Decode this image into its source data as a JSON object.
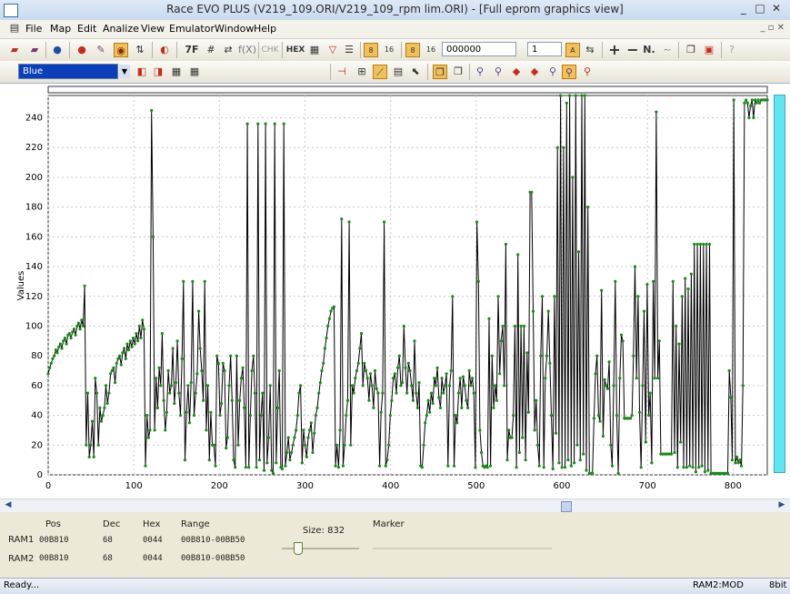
{
  "window": {
    "title": "Race EVO PLUS (V219_109.ORI/V219_109_rpm lim.ORI) - [Full eprom graphics view]"
  },
  "menu": [
    "File",
    "Map",
    "Edit",
    "Analize",
    "View",
    "Emulator",
    "Window",
    "Help"
  ],
  "toolbar": {
    "labels": {
      "hex": "HEX",
      "chk": "CHK",
      "fx": "f(X)",
      "seven_f": "7F"
    },
    "address_value": "000000",
    "step_value": "1",
    "color_combo": "Blue"
  },
  "chart_data": {
    "type": "line",
    "ylabel": "Values",
    "xlim": [
      0,
      840
    ],
    "ylim": [
      0,
      255
    ],
    "x_ticks": [
      0,
      100,
      200,
      300,
      400,
      500,
      600,
      700,
      800
    ],
    "y_ticks": [
      0,
      20,
      40,
      60,
      80,
      100,
      120,
      140,
      160,
      180,
      200,
      220,
      240
    ],
    "line_color": "#000000",
    "marker_color": "#1a8a1a",
    "grid": true,
    "values": [
      68,
      72,
      75,
      78,
      80,
      84,
      82,
      86,
      88,
      85,
      90,
      92,
      88,
      94,
      95,
      92,
      96,
      98,
      94,
      100,
      102,
      98,
      104,
      100,
      127,
      20,
      55,
      12,
      20,
      36,
      12,
      65,
      55,
      20,
      45,
      36,
      40,
      45,
      60,
      48,
      55,
      68,
      70,
      72,
      62,
      75,
      78,
      80,
      74,
      82,
      85,
      78,
      88,
      84,
      90,
      86,
      92,
      88,
      95,
      90,
      100,
      92,
      104,
      98,
      6,
      40,
      25,
      30,
      245,
      160,
      30,
      65,
      45,
      72,
      60,
      95,
      50,
      30,
      42,
      70,
      55,
      60,
      85,
      48,
      62,
      90,
      55,
      40,
      78,
      130,
      10,
      42,
      60,
      35,
      62,
      130,
      40,
      55,
      68,
      110,
      85,
      70,
      50,
      130,
      30,
      60,
      10,
      42,
      20,
      20,
      6,
      80,
      75,
      40,
      48,
      75,
      70,
      18,
      25,
      60,
      80,
      50,
      10,
      5,
      80,
      20,
      50,
      65,
      72,
      45,
      5,
      236,
      5,
      40,
      70,
      80,
      55,
      5,
      236,
      10,
      40,
      55,
      3,
      236,
      8,
      25,
      60,
      3,
      1,
      236,
      8,
      45,
      70,
      5,
      4,
      236,
      6,
      15,
      25,
      10,
      15,
      20,
      25,
      30,
      40,
      55,
      60,
      8,
      30,
      20,
      12,
      25,
      30,
      35,
      15,
      28,
      40,
      45,
      55,
      62,
      70,
      75,
      85,
      92,
      100,
      105,
      110,
      112,
      113,
      6,
      20,
      5,
      30,
      172,
      6,
      20,
      40,
      50,
      170,
      20,
      60,
      55,
      65,
      70,
      75,
      85,
      95,
      60,
      75,
      70,
      65,
      50,
      68,
      60,
      45,
      70,
      58,
      55,
      6,
      42,
      55,
      170,
      6,
      10,
      20,
      40,
      50,
      65,
      68,
      55,
      72,
      80,
      60,
      62,
      100,
      72,
      55,
      75,
      70,
      60,
      50,
      90,
      55,
      45,
      62,
      6,
      5,
      20,
      35,
      40,
      50,
      42,
      55,
      48,
      65,
      60,
      72,
      52,
      45,
      65,
      55,
      60,
      68,
      6,
      60,
      70,
      120,
      6,
      40,
      35,
      55,
      65,
      45,
      66,
      60,
      50,
      45,
      70,
      60,
      65,
      55,
      5,
      170,
      130,
      30,
      15,
      6,
      5,
      6,
      5,
      105,
      6,
      80,
      45,
      60,
      50,
      120,
      68,
      90,
      100,
      60,
      155,
      10,
      30,
      25,
      25,
      40,
      100,
      5,
      148,
      15,
      100,
      25,
      100,
      10,
      82,
      42,
      190,
      190,
      110,
      30,
      50,
      20,
      6,
      80,
      120,
      5,
      65,
      80,
      110,
      75,
      40,
      4,
      120,
      28,
      220,
      8,
      260,
      5,
      220,
      5,
      250,
      10,
      260,
      6,
      200,
      8,
      255,
      20,
      150,
      10,
      255,
      14,
      255,
      3,
      180,
      1,
      1,
      1,
      38,
      68,
      80,
      40,
      36,
      124,
      26,
      64,
      60,
      58,
      76,
      20,
      6,
      60,
      130,
      40,
      1,
      65,
      94,
      90,
      38,
      38,
      38,
      38,
      38,
      40,
      80,
      140,
      65,
      120,
      42,
      5,
      60,
      110,
      22,
      128,
      40,
      55,
      8,
      130,
      65,
      244,
      65,
      90,
      14,
      14,
      14,
      14,
      14,
      14,
      14,
      14,
      130,
      15,
      100,
      5,
      88,
      22,
      120,
      5,
      132,
      5,
      125,
      6,
      135,
      5,
      155,
      2,
      155,
      5,
      155,
      6,
      155,
      2,
      155,
      3,
      155,
      1,
      1,
      1,
      1,
      1,
      1,
      1,
      1,
      1,
      1,
      1,
      1,
      70,
      52,
      10,
      252,
      8,
      12,
      8,
      10,
      6,
      60,
      250,
      252,
      250,
      240,
      248,
      252,
      240,
      252,
      250,
      252,
      250,
      252,
      252,
      252,
      252,
      252
    ]
  },
  "status_panel": {
    "headers": [
      "Pos",
      "Dec",
      "Hex",
      "Range"
    ],
    "ram1": {
      "label": "RAM1",
      "pos": "00B810",
      "dec": "68",
      "hex": "0044",
      "range": "00B810-00BB50"
    },
    "ram2": {
      "label": "RAM2",
      "pos": "00B810",
      "dec": "68",
      "hex": "0044",
      "range": "00B810-00BB50"
    },
    "size": "Size: 832",
    "marker": "Marker"
  },
  "statusbar": {
    "left": "Ready...",
    "mode": "RAM2:MOD",
    "bits": "8bit"
  }
}
